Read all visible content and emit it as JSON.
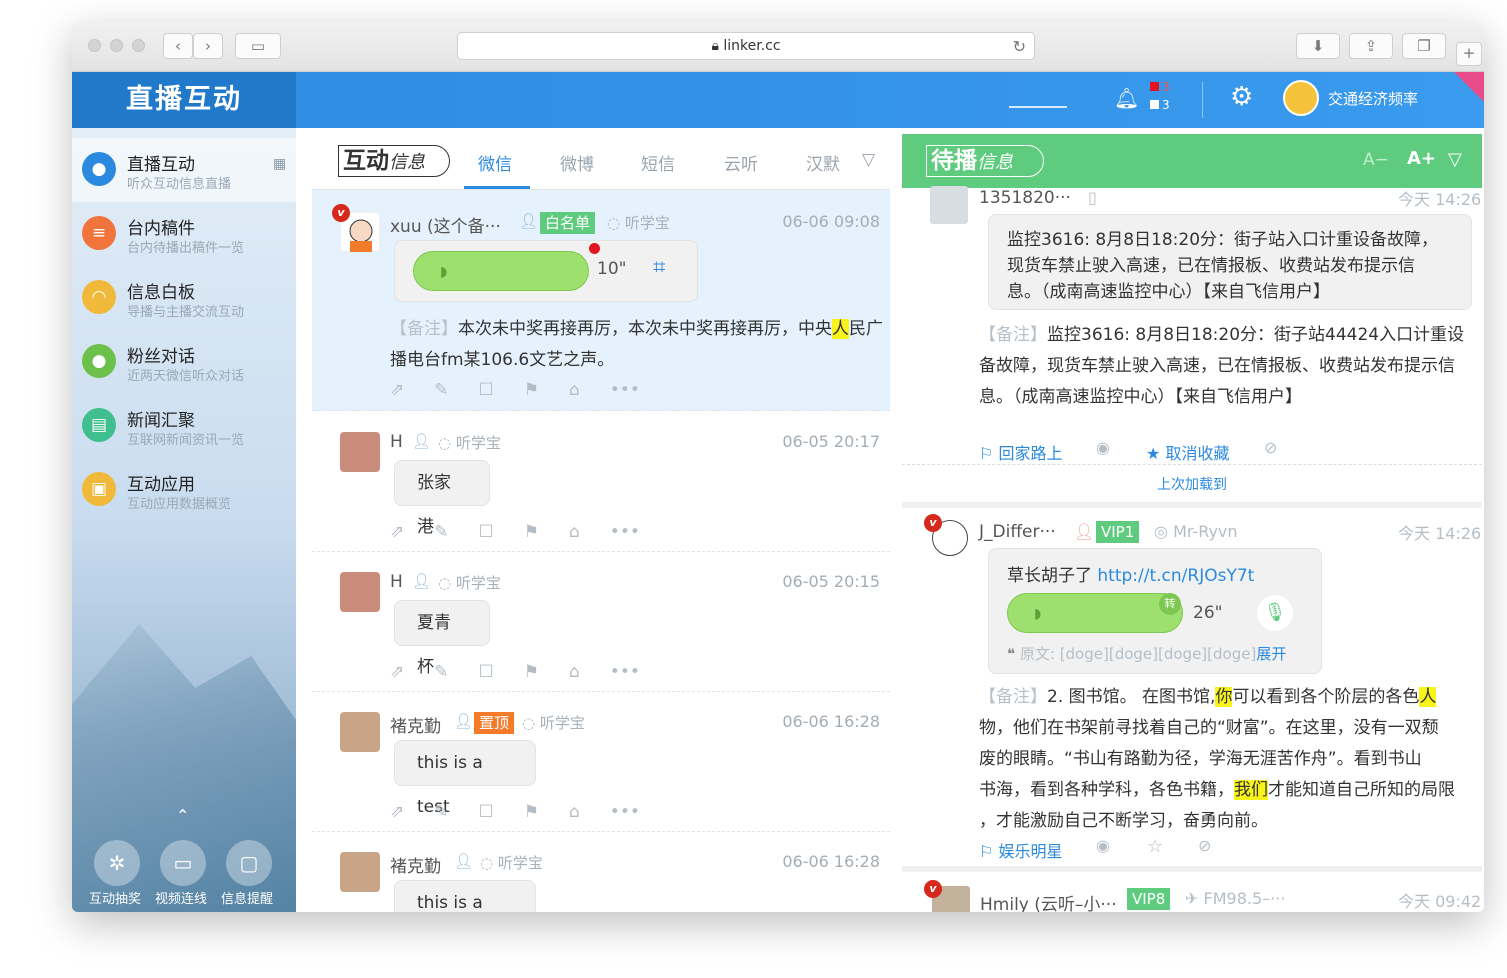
{
  "browser": {
    "url": "linker.cc",
    "lock_icon": "lock-icon"
  },
  "header": {
    "logo": "直播互动",
    "alerts": {
      "red_count": "3",
      "white_count": "3",
      "red_color": "#e1151f"
    },
    "station": "交通经济频率"
  },
  "sidebar": {
    "items": [
      {
        "title": "直播互动",
        "sub": "听众互动信息直播",
        "icon": "chat-bubble-icon",
        "color": "#2b8ae0",
        "glyph": "●"
      },
      {
        "title": "台内稿件",
        "sub": "台内待播出稿件一览",
        "icon": "document-icon",
        "color": "#f0743c",
        "glyph": "≡"
      },
      {
        "title": "信息白板",
        "sub": "导播与主播交流互动",
        "icon": "whiteboard-icon",
        "color": "#f0b93a",
        "glyph": "◠"
      },
      {
        "title": "粉丝对话",
        "sub": "近两天微信听众对话",
        "icon": "user-chat-icon",
        "color": "#6cc14a",
        "glyph": "●"
      },
      {
        "title": "新闻汇聚",
        "sub": "互联网新闻资讯一览",
        "icon": "news-icon",
        "color": "#3fbf8f",
        "glyph": "▤"
      },
      {
        "title": "互动应用",
        "sub": "互动应用数据概览",
        "icon": "gift-icon",
        "color": "#f0b93a",
        "glyph": "▣"
      }
    ],
    "tools": [
      {
        "label": "互动抽奖",
        "icon": "lottery-icon",
        "glyph": "✲"
      },
      {
        "label": "视频连线",
        "icon": "video-icon",
        "glyph": "▭"
      },
      {
        "label": "信息提醒",
        "icon": "reminder-icon",
        "glyph": "▢"
      }
    ]
  },
  "middle": {
    "brand": "互动",
    "brand_suffix": "信息",
    "tabs": [
      "微信",
      "微博",
      "短信",
      "云听",
      "汉默"
    ],
    "messages": [
      {
        "user": "xuu (这个备···",
        "tag": "白名单",
        "tag_color": "#5fcb7f",
        "source": "听学宝",
        "time": "06-06 09:08",
        "voice_len": "10\"",
        "note_label": "【备注】",
        "note_a": "本次未中奖再接再厉，本次未中奖再接再厉，中央",
        "note_hl": "人",
        "note_b": "民广播电台fm某106.6文艺之声。"
      },
      {
        "user": "H",
        "source": "听学宝",
        "time": "06-05 20:17",
        "text": "张家港"
      },
      {
        "user": "H",
        "source": "听学宝",
        "time": "06-05 20:15",
        "text": "夏青杯"
      },
      {
        "user": "褚克勤",
        "tag": "置顶",
        "tag_color": "#f47b2a",
        "source": "听学宝",
        "time": "06-06 16:28",
        "text": "this is a test"
      },
      {
        "user": "褚克勤",
        "source": "听学宝",
        "time": "06-06 16:28",
        "text": "this is a test"
      }
    ]
  },
  "right": {
    "brand": "待播",
    "brand_suffix": "信息",
    "font_small": "A−",
    "font_big": "A+",
    "item1": {
      "user": "1351820···",
      "time": "今天 14:26",
      "bubble_line1": "监控3616: 8月8日18:20分：街子站入口计重设备故障，",
      "bubble_line2": "现货车禁止驶入高速，已在情报板、收费站发布提示信",
      "bubble_line3": "息。（成南高速监控中心）【来自飞信用户】",
      "note_label": "【备注】",
      "note_line1": "监控3616: 8月8日18:20分：街子站44424入口计重设",
      "note_line2": "备故障，现货车禁止驶入高速，已在情报板、收费站发布提示信",
      "note_line3": "息。（成南高速监控中心）【来自飞信用户】",
      "flag_label": "回家路上",
      "fav_label": "取消收藏"
    },
    "load_more": "上次加载到",
    "item2": {
      "user": "J_Differ···",
      "vip": "VIP1",
      "source": "Mr-Ryvn",
      "time": "今天 14:26",
      "text": "草长胡子了",
      "link": "http://t.cn/RJOsY7t",
      "voice_len": "26\"",
      "voice_badge": "转",
      "origin_label": "原文:",
      "origin_text": "[doge][doge][doge][doge]",
      "expand": "展开",
      "note_label": "【备注】",
      "note_1a": "2. 图书馆。 在图书馆,",
      "note_1hl": "你",
      "note_1b": "可以看到各个阶层的各色",
      "note_1hl2": "人",
      "note_2": "物，他们在书架前寻找着自己的“财富”。在这里，没有一双颓",
      "note_3": "废的眼睛。“书山有路勤为径，学海无涯苦作舟”。看到书山",
      "note_4a": "书海，看到各种学科，各色书籍，",
      "note_4hl": "我们",
      "note_4b": "才能知道自己所知的局限",
      "note_5": "，才能激励自己不断学习，奋勇向前。",
      "flag_label": "娱乐明星"
    },
    "item3": {
      "user": "Hmily (云听–小···",
      "vip": "VIP8",
      "source": "FM98.5–···",
      "time": "今天 09:42"
    }
  }
}
